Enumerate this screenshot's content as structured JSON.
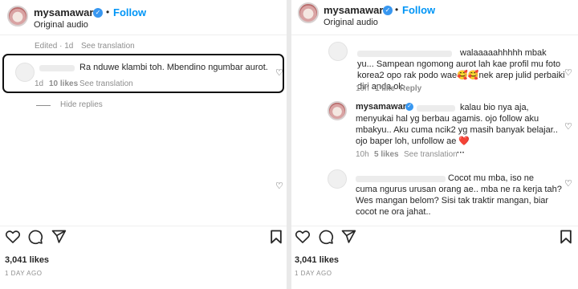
{
  "left": {
    "username": "mysamawar",
    "follow": "Follow",
    "audio": "Original audio",
    "edited_meta": "Edited · 1d",
    "see_translation_top": "See translation",
    "comment": {
      "text": "Ra nduwe klambi toh. Mbendino ngumbar aurot.",
      "time": "1d",
      "likes": "10 likes",
      "translation": "See translation"
    },
    "hide_replies": "Hide replies",
    "likes_count": "3,041 likes",
    "posted": "1 DAY AGO"
  },
  "right": {
    "username": "mysamawar",
    "follow": "Follow",
    "audio": "Original audio",
    "comment1": {
      "line1": "walaaaaahhhhh mbak",
      "line2": "yu... Sampean ngomong aurot lah kae profil mu foto",
      "line3": "korea2 opo rak podo wae🥰🥰nek arep julid perbaiki",
      "line4": "diri anda ok",
      "time": "10h",
      "likes": "1 like",
      "reply": "Reply"
    },
    "comment2": {
      "username": "mysamawar",
      "line1": "kalau bio nya aja,",
      "line2": "menyukai hal yg berbau agamis. ojo follow aku",
      "line3": "mbakyu.. Aku cuma ncik2 yg masih banyak belajar..",
      "line4": "ojo baper loh, unfollow ae ❤️",
      "time": "10h",
      "likes": "5 likes",
      "translation": "See translation",
      "more": "···"
    },
    "comment3": {
      "line1": "Cocot mu mba, iso ne",
      "line2": "cuma ngurus urusan orang ae.. mba ne ra kerja tah?",
      "line3": "Wes mangan belom? Sisi tak traktir mangan, biar",
      "line4": "cocot ne ora jahat.."
    },
    "likes_count": "3,041 likes",
    "posted": "1 DAY AGO"
  },
  "colors": {
    "follow": "#0095f6",
    "verified": "#3897f0",
    "meta": "#8e8e8e"
  }
}
